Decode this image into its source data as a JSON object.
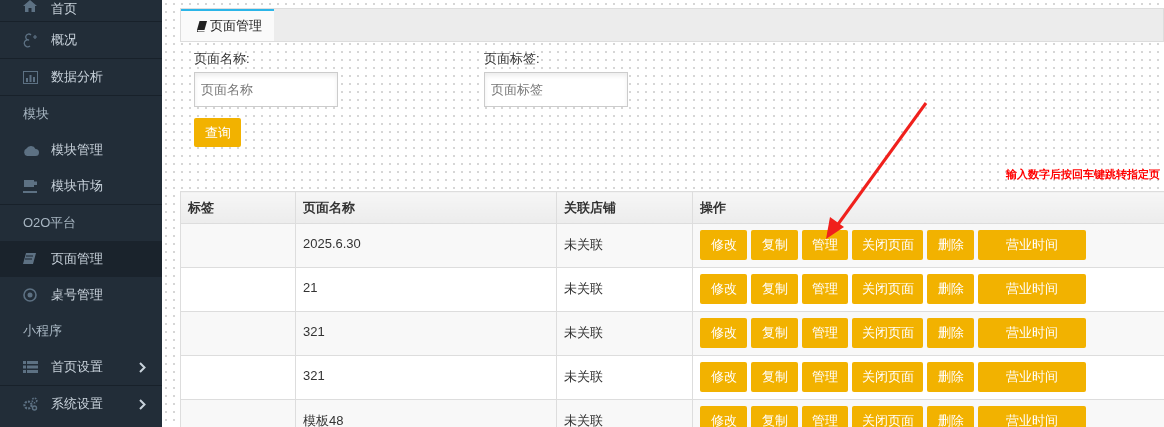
{
  "sidebar": {
    "items": [
      {
        "kind": "link",
        "label": "首页",
        "selected": false,
        "expandable": false
      },
      {
        "kind": "link",
        "label": "概况",
        "selected": false,
        "expandable": false
      },
      {
        "kind": "link",
        "label": "数据分析",
        "selected": false,
        "expandable": false
      },
      {
        "kind": "section",
        "label": "模块"
      },
      {
        "kind": "link",
        "label": "模块管理",
        "selected": false,
        "expandable": false
      },
      {
        "kind": "link",
        "label": "模块市场",
        "selected": false,
        "expandable": false
      },
      {
        "kind": "section",
        "label": "O2O平台"
      },
      {
        "kind": "link",
        "label": "页面管理",
        "selected": true,
        "expandable": false
      },
      {
        "kind": "link",
        "label": "桌号管理",
        "selected": false,
        "expandable": false
      },
      {
        "kind": "section",
        "label": "小程序"
      },
      {
        "kind": "link",
        "label": "首页设置",
        "selected": false,
        "expandable": true
      },
      {
        "kind": "link",
        "label": "系统设置",
        "selected": false,
        "expandable": true
      }
    ]
  },
  "tabs": [
    {
      "label": "页面管理",
      "selected": true
    }
  ],
  "filters": [
    {
      "label": "页面名称:",
      "placeholder": "页面名称"
    },
    {
      "label": "页面标签:",
      "placeholder": "页面标签"
    }
  ],
  "query_button": "查询",
  "hint": "输入数字后按回车键跳转指定页",
  "table": {
    "columns": [
      "标签",
      "页面名称",
      "关联店铺",
      "操作"
    ],
    "rows": [
      {
        "tag": "",
        "name": "2025.6.30",
        "store": "未关联",
        "actions": [
          "修改",
          "复制",
          "管理",
          "关闭页面",
          "删除",
          "营业时间"
        ]
      },
      {
        "tag": "",
        "name": "21",
        "store": "未关联",
        "actions": [
          "修改",
          "复制",
          "管理",
          "关闭页面",
          "删除",
          "营业时间"
        ]
      },
      {
        "tag": "",
        "name": "321",
        "store": "未关联",
        "actions": [
          "修改",
          "复制",
          "管理",
          "关闭页面",
          "删除",
          "营业时间"
        ]
      },
      {
        "tag": "",
        "name": "321",
        "store": "未关联",
        "actions": [
          "修改",
          "复制",
          "管理",
          "关闭页面",
          "删除",
          "营业时间"
        ]
      },
      {
        "tag": "",
        "name": "模板48",
        "store": "未关联",
        "actions": [
          "修改",
          "复制",
          "管理",
          "关闭页面",
          "删除",
          "营业时间"
        ]
      }
    ]
  }
}
